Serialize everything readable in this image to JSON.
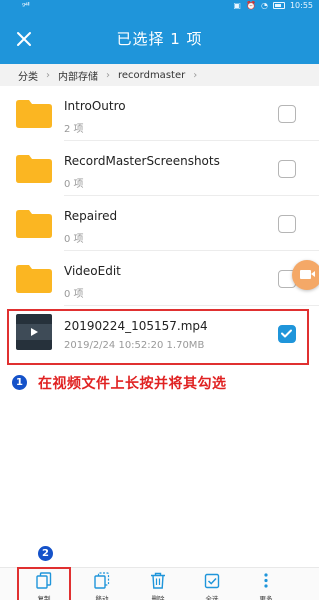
{
  "status_bar": {
    "left": "ᵍ⁴ˡˡ",
    "time": "10:55"
  },
  "header": {
    "title": "已选择 1 项"
  },
  "breadcrumb": [
    "分类",
    "内部存储",
    "recordmaster"
  ],
  "items": [
    {
      "name": "IntroOutro",
      "sub": "2 项",
      "type": "folder",
      "checked": false
    },
    {
      "name": "RecordMasterScreenshots",
      "sub": "0 项",
      "type": "folder",
      "checked": false
    },
    {
      "name": "Repaired",
      "sub": "0 项",
      "type": "folder",
      "checked": false
    },
    {
      "name": "VideoEdit",
      "sub": "0 项",
      "type": "folder",
      "checked": false
    }
  ],
  "video": {
    "name": "20190224_105157.mp4",
    "sub": "2019/2/24 10:52:20 1.70MB",
    "checked": true
  },
  "annotation": {
    "step1": "1",
    "step2": "2",
    "text": "在视频文件上长按并将其勾选"
  },
  "bottom_bar": [
    "复制",
    "移动",
    "删除",
    "全选",
    "更多"
  ],
  "colors": {
    "accent": "#1f95da",
    "folder": "#fbb622",
    "annotation": "#e03030"
  }
}
